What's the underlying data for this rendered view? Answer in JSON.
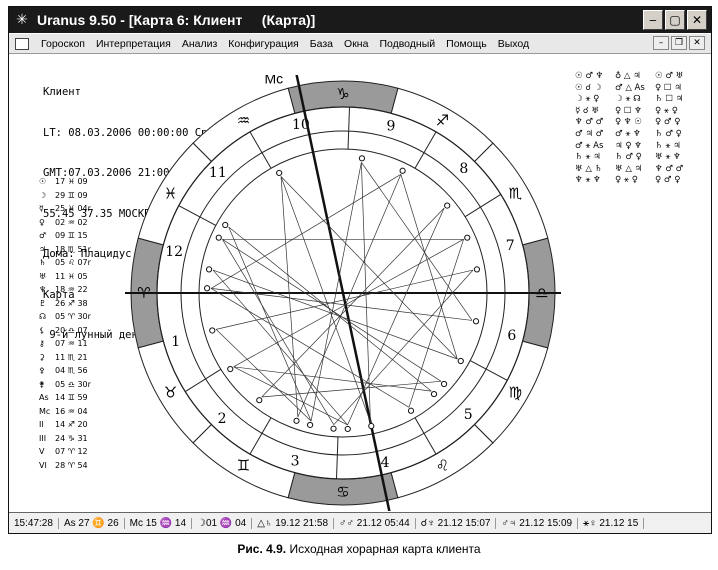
{
  "window": {
    "title": "Uranus 9.50 - [Карта 6: Клиент     (Карта)]",
    "app_icon": "uranus-logo-icon",
    "controls": [
      "minimize-icon",
      "maximize-icon",
      "close-icon"
    ]
  },
  "menu": {
    "items": [
      "Гороскоп",
      "Интерпретация",
      "Анализ",
      "Конфигурация",
      "База",
      "Окна",
      "Подводный",
      "Помощь",
      "Выход"
    ]
  },
  "info": {
    "name": "Клиент",
    "lt": "LT: 08.03.2006 00:00:00 Ср",
    "gmt": "GMT:07.03.2006 21:00:00",
    "coords": "55.45 37.35 МОСКВА",
    "houses": "Дома: Плацидус",
    "type": "Карта",
    "lunar_day": " 9-й лунный день"
  },
  "planets": [
    {
      "glyph": "☉",
      "pos": "17 ♓ 09"
    },
    {
      "glyph": "☽",
      "pos": "29 ♊ 09"
    },
    {
      "glyph": "☿",
      "pos": "25 ♓ 04r"
    },
    {
      "glyph": "♀",
      "pos": "02 ♒ 02"
    },
    {
      "glyph": "♂",
      "pos": "09 ♊ 15"
    },
    {
      "glyph": "♃",
      "pos": "18 ♏ 51r"
    },
    {
      "glyph": "♄",
      "pos": "05 ♌ 07r"
    },
    {
      "glyph": "♅",
      "pos": "11 ♓ 05"
    },
    {
      "glyph": "♆",
      "pos": "18 ♒ 22"
    },
    {
      "glyph": "♇",
      "pos": "26 ♐ 38"
    },
    {
      "glyph": "☊",
      "pos": "05 ♈ 30r"
    },
    {
      "glyph": "⚸",
      "pos": "20 ♎ 07"
    },
    {
      "glyph": "⚷",
      "pos": "07 ♒ 11"
    },
    {
      "glyph": "⚳",
      "pos": "11 ♏ 21"
    },
    {
      "glyph": "⚴",
      "pos": "04 ♏ 56"
    },
    {
      "glyph": "⚵",
      "pos": "05 ♎ 30r"
    },
    {
      "glyph": "As",
      "pos": "14 ♊ 59"
    },
    {
      "glyph": "Mc",
      "pos": "16 ♒ 04"
    },
    {
      "glyph": "II",
      "pos": "14 ♐ 20"
    },
    {
      "glyph": "III",
      "pos": "24 ♑ 31"
    },
    {
      "glyph": "V",
      "pos": "07 ♈ 12"
    },
    {
      "glyph": "VI",
      "pos": "28 ♈ 54"
    }
  ],
  "aspects": [
    [
      "☉ ♂ ♆",
      "♁ △ ♃",
      "☉ ♂ ♅"
    ],
    [
      "☉ ☌ ☽",
      "♂ △ As",
      "♀ ☐ ♃"
    ],
    [
      "☽ ⚹ ♀",
      "☽ ⚹ ☊",
      "♄ ☐ ♃"
    ],
    [
      "☿ ☌ ♅",
      "♀ ☐ ♆",
      "♀ ⚹ ♀"
    ],
    [
      "♆ ♂ ♂",
      "♀ ♆ ☉",
      "♀ ♂ ♀"
    ],
    [
      "♂ ♃ ♂",
      "♂ ⚹ ♆",
      "♄ ♂ ♀"
    ],
    [
      "♂ ⚹ As",
      "♃ ♀ ♆",
      "♄ ⚹ ♃"
    ],
    [
      "♄ ⚹ ♃",
      "♄ ♂ ♀",
      "♅ ⚹ ♆"
    ],
    [
      "♅ △ ♄",
      "♅ △ ♃",
      "♆ ♂ ♂"
    ],
    [
      "♆ ⚹ ♆",
      "♀ ⚹ ♀",
      "♀ ♂ ♀"
    ]
  ],
  "chart": {
    "asc_label": "As",
    "mc_label": "Mc",
    "house_numbers": [
      "1",
      "2",
      "3",
      "4",
      "5",
      "6",
      "7",
      "8",
      "9",
      "10",
      "11",
      "12"
    ],
    "signs": [
      "♈",
      "♉",
      "♊",
      "♋",
      "♌",
      "♍",
      "♎",
      "♏",
      "♐",
      "♑",
      "♒",
      "♓"
    ]
  },
  "status": {
    "segments": [
      "15:47:28",
      "As 27 ♊ 26",
      "Mc 15 ♒ 14",
      "☽01 ♒ 04",
      "△♄ 19.12 21:58",
      "♂♂ 21.12 05:44",
      "☌♆ 21.12 15:07",
      "♂♃ 21.12 15:09",
      "⚹♀ 21.12 15"
    ]
  },
  "caption": {
    "number": "Рис. 4.9.",
    "text": " Исходная хорарная карта клиента"
  }
}
